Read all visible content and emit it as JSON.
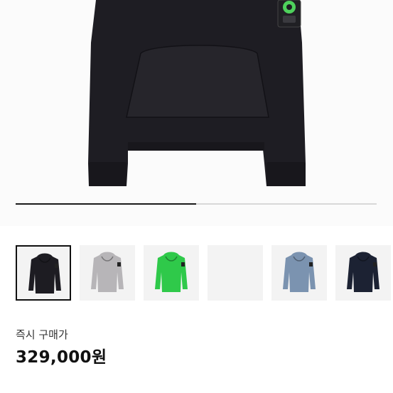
{
  "product": {
    "image_icon": "hoodie-image",
    "gallery": {
      "progress": 0.5,
      "thumbnails": [
        {
          "name": "black",
          "color": "#1d1c22",
          "selected": true
        },
        {
          "name": "grey",
          "color": "#b7b5b8",
          "selected": false
        },
        {
          "name": "green",
          "color": "#2fc94a",
          "selected": false
        },
        {
          "name": "empty",
          "color": "#f5f5f5",
          "selected": false
        },
        {
          "name": "blue",
          "color": "#7b93b0",
          "selected": false
        },
        {
          "name": "navy",
          "color": "#1c2233",
          "selected": false
        }
      ]
    },
    "purchase_label": "즉시 구매가",
    "price": "329,000원"
  },
  "colors": {
    "hoodie": "#1d1c22",
    "badge": "#4ed15c",
    "progress": "#1a1a1a"
  }
}
